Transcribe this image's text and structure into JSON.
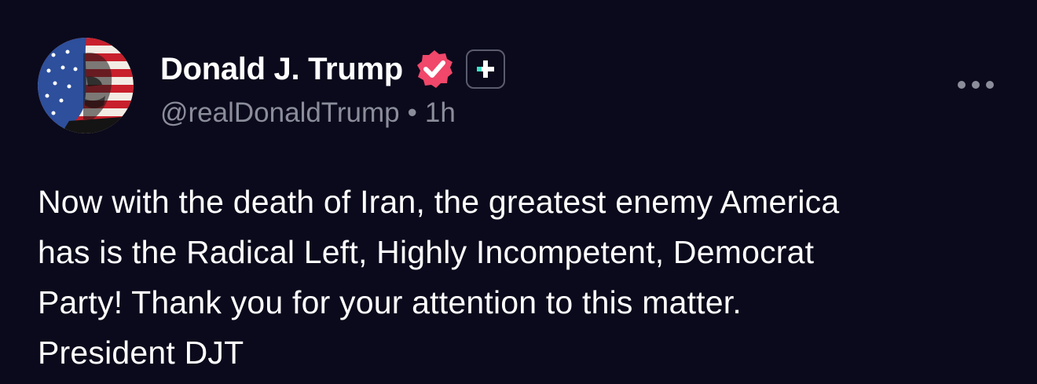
{
  "post": {
    "author": {
      "display_name": "Donald J. Trump",
      "handle": "@realDonaldTrump",
      "verified_icon": "verified-badge-icon",
      "plus_icon": "plus-badge-icon"
    },
    "separator": "•",
    "timestamp": "1h",
    "body_lines": [
      "Now with the death of Iran, the greatest enemy America",
      "has is the Radical Left, Highly Incompetent, Democrat",
      "Party! Thank you for your attention to this matter.",
      "President DJT"
    ],
    "more_icon": "more-options-icon"
  },
  "colors": {
    "background": "#0b0a1c",
    "text_primary": "#ffffff",
    "text_secondary": "#8b8d9b",
    "verified_pink": "#f0476a",
    "plus_teal": "#3fe0c5"
  }
}
